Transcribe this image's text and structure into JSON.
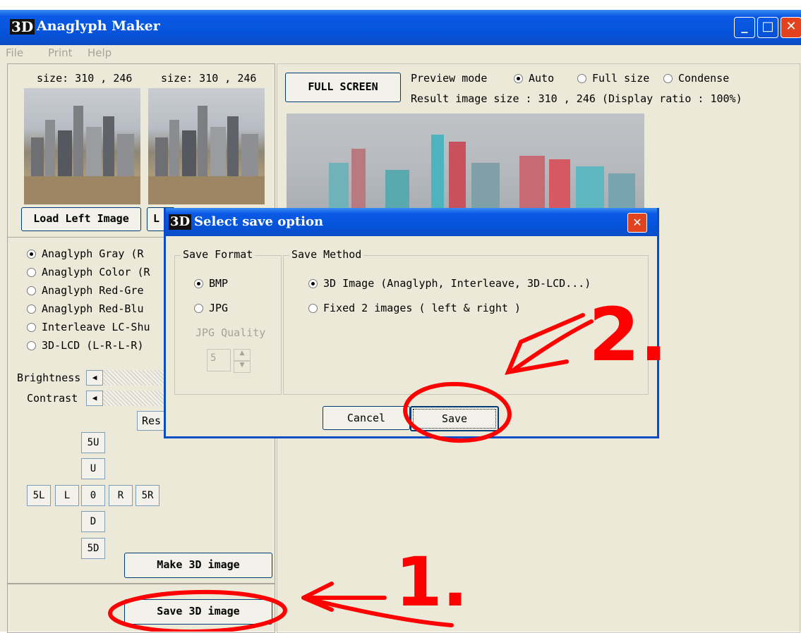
{
  "window": {
    "title": "Anaglyph Maker",
    "icon_text": "3D"
  },
  "menu": [
    "File",
    "Print",
    "Help"
  ],
  "left_image": {
    "size_label": "size: 310 , 246",
    "load_label": "Load Left Image"
  },
  "right_image": {
    "size_label": "size: 310 , 246",
    "load_label_partial": "L"
  },
  "modes": [
    {
      "label": "Anaglyph Gray (R",
      "selected": true
    },
    {
      "label": "Anaglyph Color (R",
      "selected": false
    },
    {
      "label": "Anaglyph Red-Gre",
      "selected": false
    },
    {
      "label": "Anaglyph Red-Blu",
      "selected": false
    },
    {
      "label": "Interleave LC-Shu",
      "selected": false
    },
    {
      "label": "3D-LCD (L-R-L-R)",
      "selected": false
    }
  ],
  "adjust": {
    "brightness_label": "Brightness",
    "contrast_label": "Contrast",
    "reset_partial": "Res"
  },
  "nudge": {
    "up5": "5U",
    "up": "U",
    "left5": "5L",
    "left": "L",
    "zero": "0",
    "right": "R",
    "right5": "5R",
    "down": "D",
    "down5": "5D"
  },
  "actions": {
    "make": "Make 3D image",
    "save": "Save 3D image"
  },
  "preview": {
    "fullscreen": "FULL SCREEN",
    "mode_label": "Preview mode",
    "options": [
      {
        "label": "Auto",
        "selected": true
      },
      {
        "label": "Full size",
        "selected": false
      },
      {
        "label": "Condense",
        "selected": false
      }
    ],
    "result_text": "Result image size :  310 , 246  (Display ratio : 100%)"
  },
  "dialog": {
    "title": "Select save option",
    "format_label": "Save Format",
    "formats": [
      {
        "label": "BMP",
        "selected": true
      },
      {
        "label": "JPG",
        "selected": false
      }
    ],
    "jpg_quality_label": "JPG Quality",
    "jpg_quality_value": "5",
    "method_label": "Save Method",
    "methods": [
      {
        "label": "3D Image (Anaglyph, Interleave, 3D-LCD...)",
        "selected": true
      },
      {
        "label": "Fixed 2 images ( left & right )",
        "selected": false
      }
    ],
    "cancel": "Cancel",
    "save": "Save"
  },
  "annotations": {
    "step1": "1.",
    "step2": "2."
  },
  "colors": {
    "title_blue": "#0554dc",
    "face": "#ece9d8",
    "annotation_red": "#ff0000",
    "close_red": "#e2421e"
  }
}
